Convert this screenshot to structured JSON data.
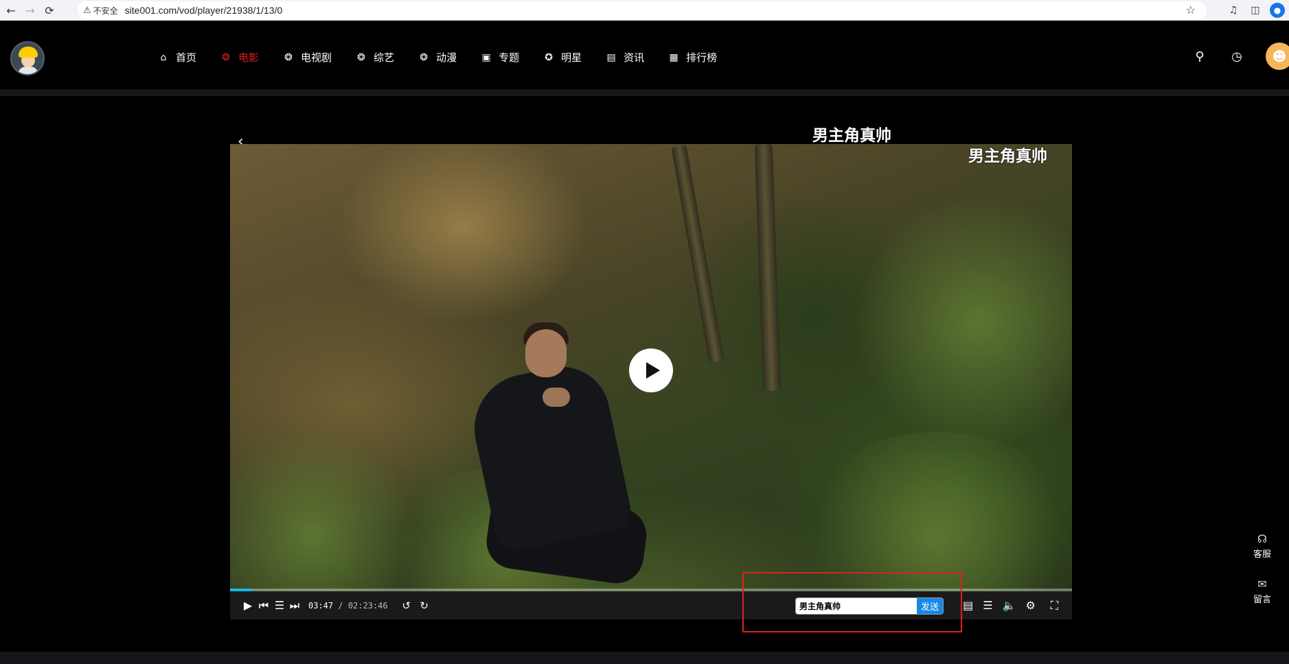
{
  "browser": {
    "insecure_label": "不安全",
    "url": "site001.com/vod/player/21938/1/13/0"
  },
  "nav": {
    "items": [
      {
        "label": "首页",
        "icon": "home-icon"
      },
      {
        "label": "电影",
        "icon": "film-reel-icon",
        "active": true
      },
      {
        "label": "电视剧",
        "icon": "tv-reel-icon"
      },
      {
        "label": "综艺",
        "icon": "variety-reel-icon"
      },
      {
        "label": "动漫",
        "icon": "anime-reel-icon"
      },
      {
        "label": "专题",
        "icon": "topic-icon"
      },
      {
        "label": "明星",
        "icon": "star-icon"
      },
      {
        "label": "资讯",
        "icon": "news-icon"
      },
      {
        "label": "排行榜",
        "icon": "calendar-icon"
      }
    ],
    "active_color": "#e01b1b"
  },
  "player": {
    "danmu_overlay": [
      "男主角真帅",
      "男主角真帅"
    ],
    "current_time": "03:47",
    "separator": " / ",
    "total_time": "02:23:46",
    "progress": 0.026,
    "accent_color": "#19b8e8",
    "danmu_input_value": "男主角真帅",
    "danmu_send_label": "发送"
  },
  "side": {
    "service_label": "客服",
    "message_label": "留言"
  }
}
